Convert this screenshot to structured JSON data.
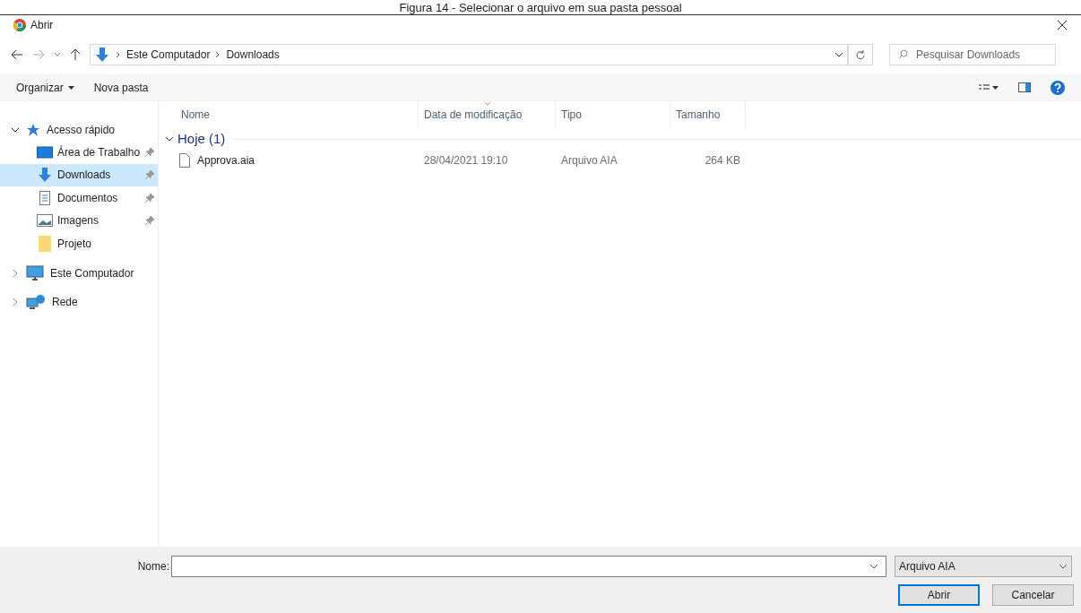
{
  "caption": "Figura 14 - Selecionar o arquivo em sua pasta pessoal",
  "window": {
    "title": "Abrir"
  },
  "address": {
    "path": [
      "Este Computador",
      "Downloads"
    ]
  },
  "search": {
    "placeholder": "Pesquisar Downloads"
  },
  "toolbar": {
    "organize": "Organizar",
    "new_folder": "Nova pasta"
  },
  "sidebar": {
    "items": [
      {
        "label": "Acesso rápido",
        "kind": "star",
        "expanded": true,
        "selected": false,
        "children": [
          {
            "label": "Área de Trabalho",
            "kind": "desktop",
            "pinned": true,
            "selected": false
          },
          {
            "label": "Downloads",
            "kind": "download",
            "pinned": true,
            "selected": true
          },
          {
            "label": "Documentos",
            "kind": "document",
            "pinned": true,
            "selected": false
          },
          {
            "label": "Imagens",
            "kind": "image",
            "pinned": true,
            "selected": false
          },
          {
            "label": "Projeto",
            "kind": "folder",
            "pinned": false,
            "selected": false
          }
        ]
      },
      {
        "label": "Este Computador",
        "kind": "computer",
        "expanded": false,
        "selected": false
      },
      {
        "label": "Rede",
        "kind": "network",
        "expanded": false,
        "selected": false
      }
    ]
  },
  "columns": [
    "Nome",
    "Data de modificação",
    "Tipo",
    "Tamanho"
  ],
  "groups": [
    {
      "label": "Hoje (1)",
      "expanded": true,
      "rows": [
        {
          "name": "Approva.aia",
          "modified": "28/04/2021 19:10",
          "type": "Arquivo AIA",
          "size": "264 KB",
          "selected": false
        }
      ]
    }
  ],
  "footer": {
    "name_label": "Nome:",
    "filter": "Arquivo AIA",
    "buttons": [
      "Abrir",
      "Cancelar"
    ]
  }
}
